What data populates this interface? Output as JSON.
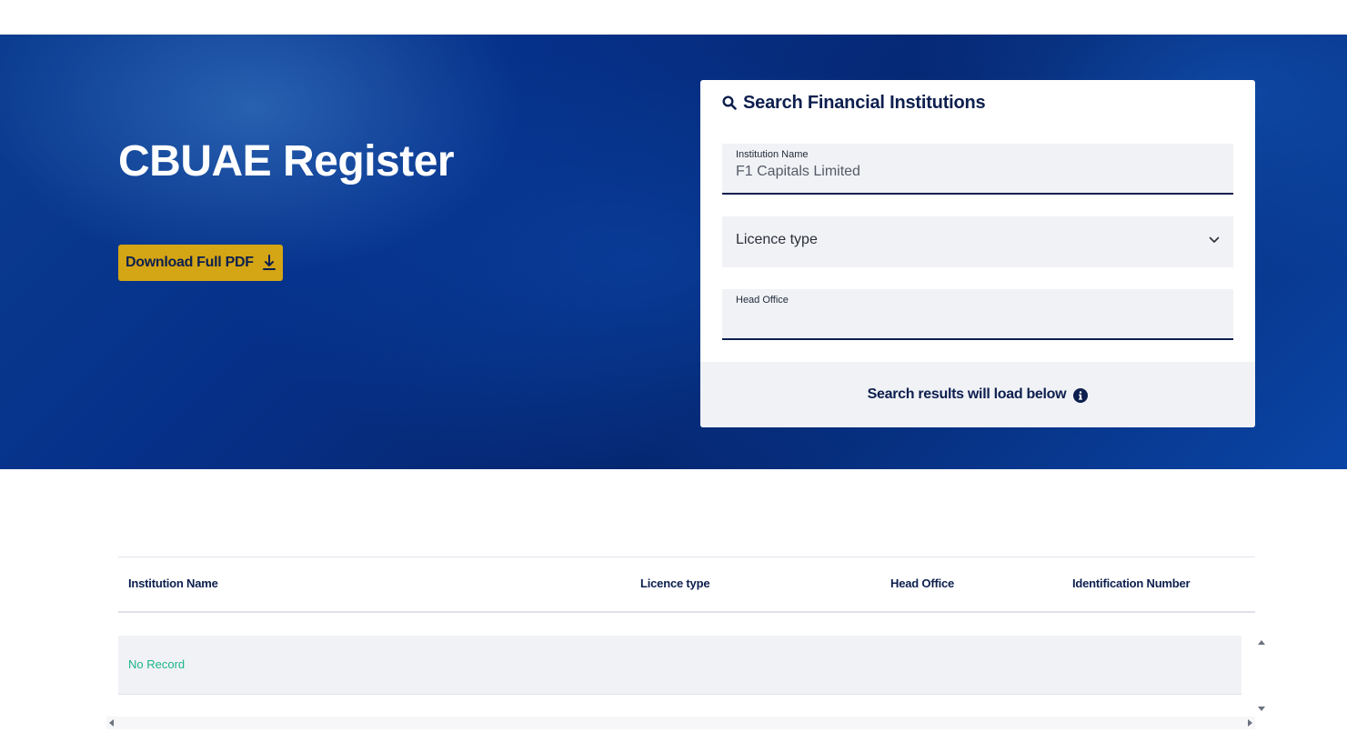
{
  "hero": {
    "title": "CBUAE Register",
    "download_label": "Download Full PDF"
  },
  "search": {
    "title": "Search Financial Institutions",
    "institution_name": {
      "label": "Institution Name",
      "value": "F1 Capitals Limited"
    },
    "licence_type": {
      "label": "Licence type"
    },
    "head_office": {
      "label": "Head Office",
      "value": ""
    },
    "footer_text": "Search results will load below"
  },
  "table": {
    "columns": [
      "Institution Name",
      "Licence type",
      "Head Office",
      "Identification Number"
    ],
    "empty_text": "No Record"
  },
  "colors": {
    "brand_navy": "#0d1f4e",
    "accent_gold": "#d4a514",
    "empty_green": "#1bb48a",
    "field_bg": "#f1f2f6"
  },
  "icons": [
    "search-icon",
    "download-icon",
    "chevron-down-icon",
    "info-icon"
  ]
}
